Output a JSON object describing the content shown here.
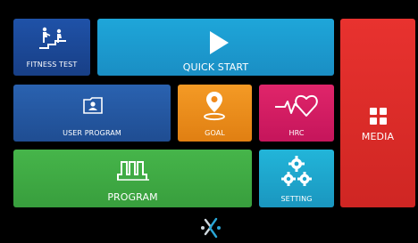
{
  "tiles": {
    "fitness_test": {
      "label": "FITNESS TEST",
      "icon": "stairs-climber-icon",
      "color": "#1f52a8"
    },
    "quick_start": {
      "label": "QUICK START",
      "icon": "play-icon",
      "color": "#1ea6d9"
    },
    "user_program": {
      "label": "USER PROGRAM",
      "icon": "user-folder-icon",
      "color": "#2a62b0"
    },
    "goal": {
      "label": "GOAL",
      "icon": "location-pin-icon",
      "color": "#f49a25"
    },
    "hrc": {
      "label": "HRC",
      "icon": "heart-rate-icon",
      "color": "#e0256a"
    },
    "program": {
      "label": "PROGRAM",
      "icon": "program-waveform-icon",
      "color": "#46b54a"
    },
    "setting": {
      "label": "SETTING",
      "icon": "gears-icon",
      "color": "#22b5d9"
    },
    "media": {
      "label": "MEDIA",
      "icon": "grid-icon",
      "color": "#e8322f"
    }
  },
  "footer": {
    "icon": "brand-logo-icon"
  }
}
